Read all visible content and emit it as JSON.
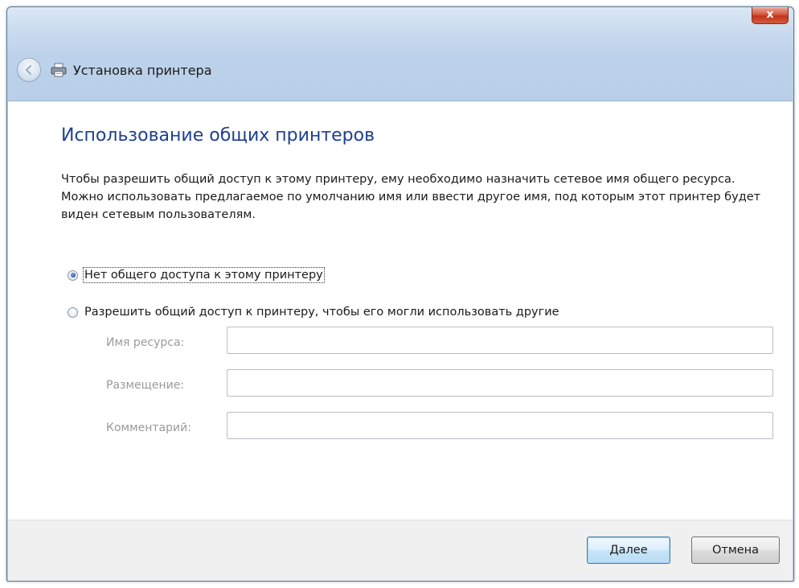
{
  "window": {
    "title": "Установка принтера",
    "close_label": "x"
  },
  "page": {
    "heading": "Использование общих принтеров",
    "description": "Чтобы разрешить общий доступ к этому принтеру, ему необходимо назначить сетевое имя общего ресурса. Можно использовать предлагаемое по умолчанию имя или ввести другое имя, под которым этот принтер будет виден сетевым пользователям."
  },
  "options": {
    "no_share": {
      "label": "Нет общего доступа к этому принтеру",
      "checked": true
    },
    "share": {
      "label": "Разрешить общий доступ к принтеру, чтобы его могли использовать другие",
      "checked": false
    }
  },
  "fields": {
    "share_name": {
      "label": "Имя ресурса:",
      "value": ""
    },
    "location": {
      "label": "Размещение:",
      "value": ""
    },
    "comment": {
      "label": "Комментарий:",
      "value": ""
    }
  },
  "buttons": {
    "next": "Далее",
    "cancel": "Отмена"
  },
  "colors": {
    "heading": "#1e3f91",
    "accent": "#3c7fb1",
    "close": "#c0351c"
  },
  "icons": {
    "back": "back-arrow-icon",
    "printer": "printer-icon",
    "close": "close-icon"
  }
}
